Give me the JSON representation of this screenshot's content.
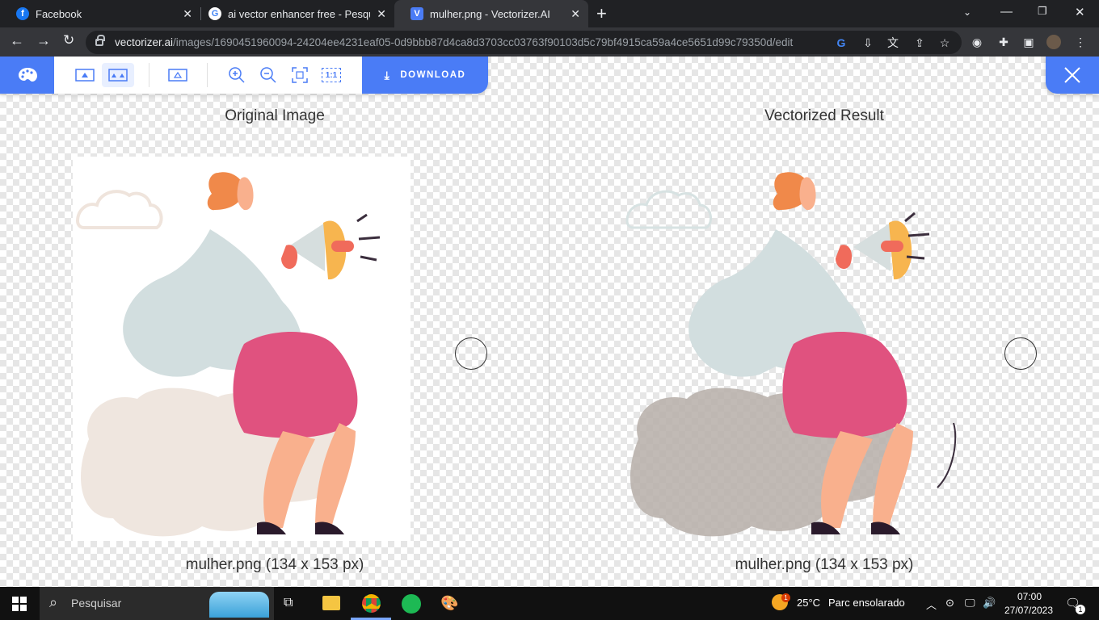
{
  "tabs": [
    {
      "title": "Facebook",
      "icon": "facebook-icon",
      "color": "#1877f2",
      "letter": "f"
    },
    {
      "title": "ai vector enhancer free - Pesquisa",
      "icon": "google-icon",
      "color": "#ffffff",
      "letter": "G"
    },
    {
      "title": "mulher.png - Vectorizer.AI",
      "icon": "vectorizer-icon",
      "color": "#4a7cf6",
      "letter": "V"
    }
  ],
  "address": {
    "host": "vectorizer.ai",
    "path": "/images/1690451960094-24204ee4231eaf05-0d9bbb87d4ca8d3703cc03763f90103d5c79bf4915ca59a4ce5651d99c79350d/edit"
  },
  "app": {
    "download_label": "DOWNLOAD",
    "zoom_fit_label": "1:1"
  },
  "left_panel": {
    "title": "Original Image",
    "caption": "mulher.png (134 x 153 px)"
  },
  "right_panel": {
    "title": "Vectorized Result",
    "caption": "mulher.png (134 x 153 px)"
  },
  "taskbar": {
    "search_placeholder": "Pesquisar",
    "weather_temp": "25°C",
    "weather_text": "Parc ensolarado",
    "time": "07:00",
    "date": "27/07/2023",
    "notification_count": "1",
    "weather_badge": "1"
  },
  "colors": {
    "accent": "#4a7cf6",
    "hair": "#f0894a",
    "skin": "#f9b08d",
    "shirt": "#d2dedf",
    "pants": "#e0527f",
    "cloud": "#efe6df",
    "megaphone": "#f7b54f"
  }
}
